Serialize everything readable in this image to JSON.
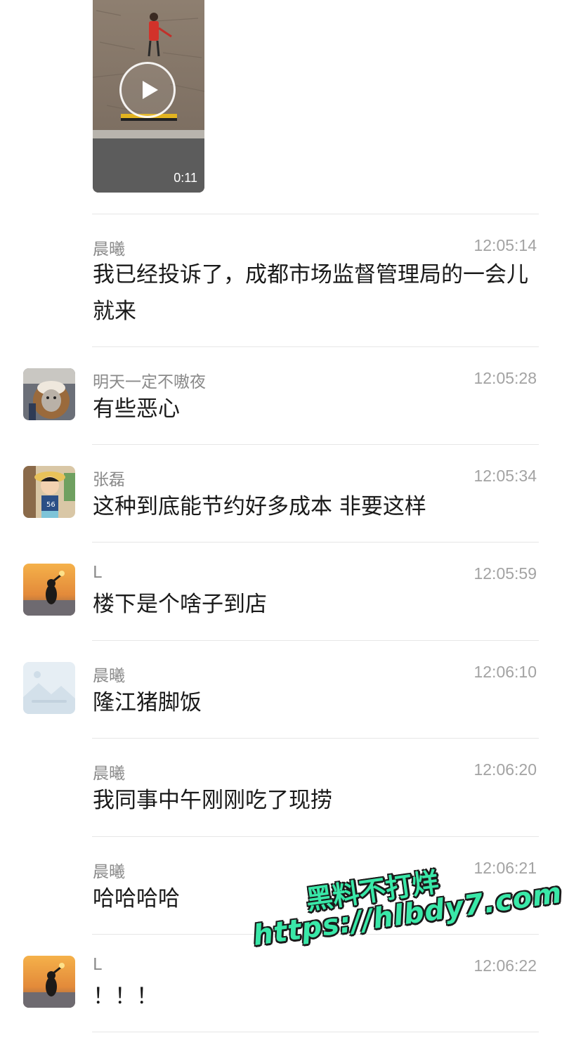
{
  "video": {
    "duration": "0:11",
    "play_icon": "play-icon"
  },
  "messages": [
    {
      "sender": "晨曦",
      "time": "12:05:14",
      "text": "我已经投诉了，成都市场监督管理局的一会儿就来",
      "avatar": "none"
    },
    {
      "sender": "明天一定不嗷夜",
      "time": "12:05:28",
      "text": "有些恶心",
      "avatar": "monkey-avatar"
    },
    {
      "sender": "张磊",
      "time": "12:05:34",
      "text": "这种到底能节约好多成本 非要这样",
      "avatar": "cartoon-boy-avatar"
    },
    {
      "sender": "L",
      "time": "12:05:59",
      "text": "楼下是个啥子到店",
      "avatar": "sunset-girl-avatar"
    },
    {
      "sender": "晨曦",
      "time": "12:06:10",
      "text": "隆江猪脚饭",
      "avatar": "landscape-placeholder-avatar"
    },
    {
      "sender": "晨曦",
      "time": "12:06:20",
      "text": "我同事中午刚刚吃了现捞",
      "avatar": "none"
    },
    {
      "sender": "晨曦",
      "time": "12:06:21",
      "text": "哈哈哈哈",
      "avatar": "none"
    },
    {
      "sender": "L",
      "time": "12:06:22",
      "text": "！！！",
      "avatar": "sunset-girl-avatar"
    }
  ],
  "watermark": {
    "line1": "黑料不打烊",
    "line2": "https://hlbdy7.com"
  },
  "colors": {
    "sender": "#8a8a8a",
    "time": "#a3a3a3",
    "text": "#1a1a1a",
    "divider": "#e6e6e6",
    "watermark": "#39e8a8"
  }
}
